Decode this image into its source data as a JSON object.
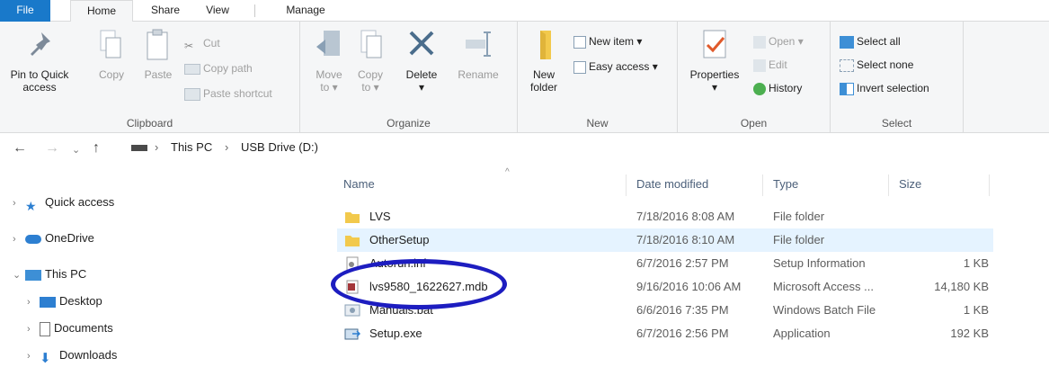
{
  "tabs": {
    "file": "File",
    "home": "Home",
    "share": "Share",
    "view": "View",
    "manage": "Manage"
  },
  "ribbon": {
    "clipboard": {
      "label": "Clipboard",
      "pin_line1": "Pin to Quick",
      "pin_line2": "access",
      "copy": "Copy",
      "paste": "Paste",
      "cut": "Cut",
      "copy_path": "Copy path",
      "paste_shortcut": "Paste shortcut"
    },
    "organize": {
      "label": "Organize",
      "move_line1": "Move",
      "move_line2": "to",
      "copy_line1": "Copy",
      "copy_line2": "to",
      "delete": "Delete",
      "rename": "Rename"
    },
    "new": {
      "label": "New",
      "new_folder_line1": "New",
      "new_folder_line2": "folder",
      "new_item": "New item",
      "easy_access": "Easy access"
    },
    "open": {
      "label": "Open",
      "properties": "Properties",
      "open": "Open",
      "edit": "Edit",
      "history": "History"
    },
    "select": {
      "label": "Select",
      "select_all": "Select all",
      "select_none": "Select none",
      "invert_selection": "Invert selection"
    }
  },
  "address": {
    "root": "This PC",
    "drive": "USB Drive (D:)"
  },
  "navpane": {
    "quick_access": "Quick access",
    "onedrive": "OneDrive",
    "this_pc": "This PC",
    "desktop": "Desktop",
    "documents": "Documents",
    "downloads": "Downloads"
  },
  "columns": {
    "name": "Name",
    "date": "Date modified",
    "type": "Type",
    "size": "Size"
  },
  "files": [
    {
      "name": "LVS",
      "date": "7/18/2016 8:08 AM",
      "type": "File folder",
      "size": ""
    },
    {
      "name": "OtherSetup",
      "date": "7/18/2016 8:10 AM",
      "type": "File folder",
      "size": ""
    },
    {
      "name": "Autorun.inf",
      "date": "6/7/2016 2:57 PM",
      "type": "Setup Information",
      "size": "1 KB"
    },
    {
      "name": "lvs9580_1622627.mdb",
      "date": "9/16/2016 10:06 AM",
      "type": "Microsoft Access ...",
      "size": "14,180 KB"
    },
    {
      "name": "Manuals.bat",
      "date": "6/6/2016 7:35 PM",
      "type": "Windows Batch File",
      "size": "1 KB"
    },
    {
      "name": "Setup.exe",
      "date": "6/7/2016 2:56 PM",
      "type": "Application",
      "size": "192 KB"
    }
  ],
  "icons": {
    "folder": "folder-icon",
    "pin": "pin-icon",
    "delete": "delete-x-icon",
    "properties": "properties-check-icon",
    "up": "up-arrow-icon"
  },
  "colors": {
    "file_tab": "#1979ca",
    "folder": "#f2c94c",
    "highlight_circle": "#1d1dc0",
    "selected_row": "#e5f3ff"
  }
}
